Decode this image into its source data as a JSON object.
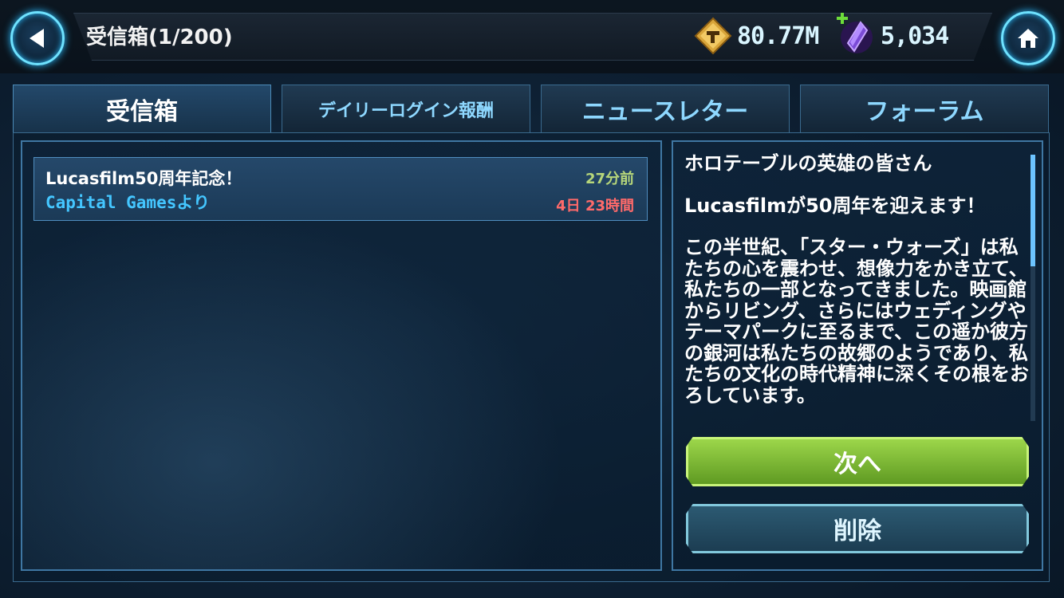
{
  "header": {
    "title": "受信箱(1/200)",
    "back_icon": "back-arrow-icon",
    "home_icon": "home-icon",
    "credits": {
      "icon": "credits-icon",
      "value": "80.77M"
    },
    "crystals": {
      "icon": "crystal-icon",
      "value": "5,034",
      "add_icon": "plus-icon"
    }
  },
  "tabs": [
    {
      "label": "受信箱",
      "active": true
    },
    {
      "label": "デイリーログイン報酬",
      "active": false
    },
    {
      "label": "ニュースレター",
      "active": false
    },
    {
      "label": "フォーラム",
      "active": false
    }
  ],
  "mail_list": [
    {
      "subject": "Lucasfilm50周年記念！",
      "sender": "Capital Gamesより",
      "received": "27分前",
      "expires": "4日 23時間"
    }
  ],
  "message": {
    "greeting": "ホロテーブルの英雄の皆さん",
    "headline": "Lucasfilmが50周年を迎えます！",
    "body": "この半世紀、「スター・ウォーズ」は私たちの心を震わせ、想像力をかき立て、私たちの一部となってきました。映画館からリビング、さらにはウェディングやテーマパークに至るまで、この遥か彼方の銀河は私たちの故郷のようであり、私たちの文化の時代精神に深くその根をおろしています。"
  },
  "buttons": {
    "next": "次へ",
    "delete": "削除"
  },
  "colors": {
    "accent": "#6ee2ff",
    "next_button": "#7dbb35",
    "delete_button": "#2c5a72",
    "time_text": "#b7d77a",
    "expire_text": "#ff6a6a",
    "sender_text": "#44c6ff"
  }
}
